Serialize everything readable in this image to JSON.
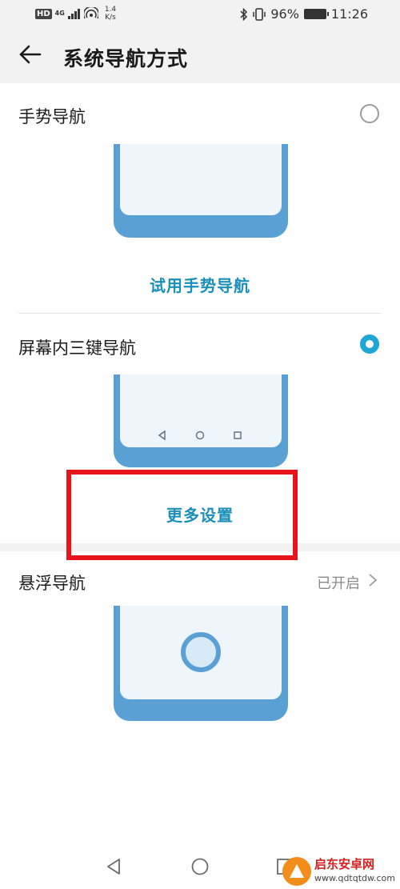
{
  "status_bar": {
    "hd": "HD",
    "network": "4G",
    "speed_value": "1.4",
    "speed_unit": "K/s",
    "battery": "96%",
    "time": "11:26"
  },
  "header": {
    "title": "系统导航方式"
  },
  "options": [
    {
      "label": "手势导航",
      "selected": false,
      "link": "试用手势导航"
    },
    {
      "label": "屏幕内三键导航",
      "selected": true,
      "link": "更多设置"
    },
    {
      "label": "悬浮导航",
      "status": "已开启"
    }
  ],
  "colors": {
    "accent": "#1ea6d6",
    "phone_frame": "#5aa0d5",
    "highlight": "#e8141c",
    "link": "#1a8fb8"
  },
  "watermark": {
    "name": "启东安卓网",
    "url": "www.qdtqtdw.com"
  }
}
